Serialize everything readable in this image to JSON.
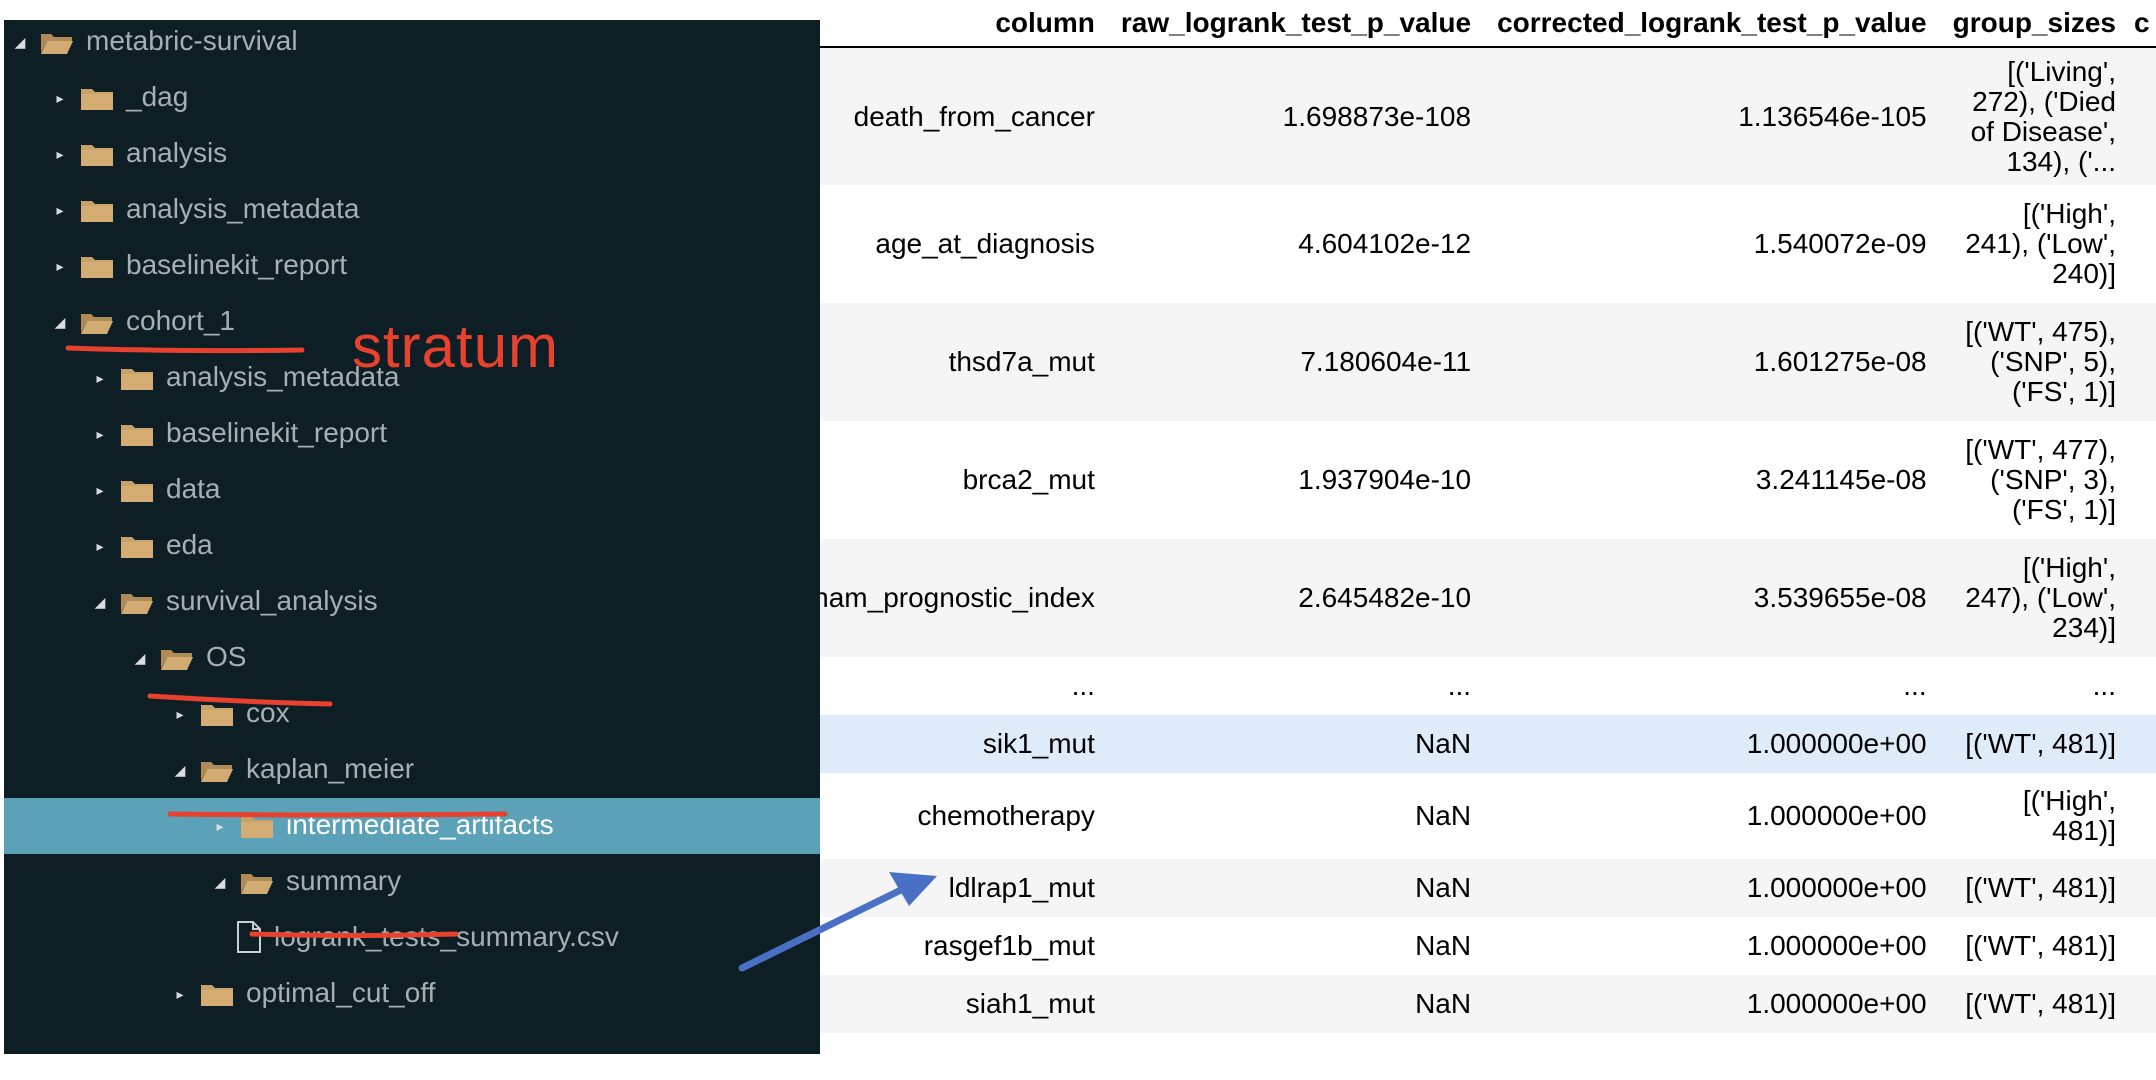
{
  "table": {
    "headers": [
      "column",
      "raw_logrank_test_p_value",
      "corrected_logrank_test_p_value",
      "group_sizes",
      "c"
    ],
    "rows": [
      {
        "column": "death_from_cancer",
        "raw": "1.698873e-108",
        "corrected": "1.136546e-105",
        "group_sizes": "[('Living', 272), ('Died of Disease', 134), ('...",
        "extra": "",
        "style": "odd"
      },
      {
        "column": "age_at_diagnosis",
        "raw": "4.604102e-12",
        "corrected": "1.540072e-09",
        "group_sizes": "[('High', 241), ('Low', 240)]",
        "extra": "",
        "style": "even"
      },
      {
        "column": "thsd7a_mut",
        "raw": "7.180604e-11",
        "corrected": "1.601275e-08",
        "group_sizes": "[('WT', 475), ('SNP', 5), ('FS', 1)]",
        "extra": "",
        "style": "odd"
      },
      {
        "column": "brca2_mut",
        "raw": "1.937904e-10",
        "corrected": "3.241145e-08",
        "group_sizes": "[('WT', 477), ('SNP', 3), ('FS', 1)]",
        "extra": "",
        "style": "even"
      },
      {
        "column": "nottingham_prognostic_index",
        "raw": "2.645482e-10",
        "corrected": "3.539655e-08",
        "group_sizes": "[('High', 247), ('Low', 234)]",
        "extra": "",
        "style": "odd"
      },
      {
        "column": "...",
        "raw": "...",
        "corrected": "...",
        "group_sizes": "...",
        "extra": "",
        "style": "even"
      },
      {
        "column": "sik1_mut",
        "raw": "NaN",
        "corrected": "1.000000e+00",
        "group_sizes": "[('WT', 481)]",
        "extra": "",
        "style": "hover"
      },
      {
        "column": "chemotherapy",
        "raw": "NaN",
        "corrected": "1.000000e+00",
        "group_sizes": "[('High', 481)]",
        "extra": "",
        "style": "even"
      },
      {
        "column": "ldlrap1_mut",
        "raw": "NaN",
        "corrected": "1.000000e+00",
        "group_sizes": "[('WT', 481)]",
        "extra": "",
        "style": "odd"
      },
      {
        "column": "rasgef1b_mut",
        "raw": "NaN",
        "corrected": "1.000000e+00",
        "group_sizes": "[('WT', 481)]",
        "extra": "",
        "style": "even"
      },
      {
        "column": "siah1_mut",
        "raw": "NaN",
        "corrected": "1.000000e+00",
        "group_sizes": "[('WT', 481)]",
        "extra": "",
        "style": "odd"
      }
    ]
  },
  "tree": [
    {
      "label": "metabric-survival",
      "depth": 0,
      "kind": "folder",
      "expanded": true,
      "selected": false
    },
    {
      "label": "_dag",
      "depth": 1,
      "kind": "folder",
      "expanded": false,
      "selected": false
    },
    {
      "label": "analysis",
      "depth": 1,
      "kind": "folder",
      "expanded": false,
      "selected": false
    },
    {
      "label": "analysis_metadata",
      "depth": 1,
      "kind": "folder",
      "expanded": false,
      "selected": false
    },
    {
      "label": "baselinekit_report",
      "depth": 1,
      "kind": "folder",
      "expanded": false,
      "selected": false
    },
    {
      "label": "cohort_1",
      "depth": 1,
      "kind": "folder",
      "expanded": true,
      "selected": false
    },
    {
      "label": "analysis_metadata",
      "depth": 2,
      "kind": "folder",
      "expanded": false,
      "selected": false
    },
    {
      "label": "baselinekit_report",
      "depth": 2,
      "kind": "folder",
      "expanded": false,
      "selected": false
    },
    {
      "label": "data",
      "depth": 2,
      "kind": "folder",
      "expanded": false,
      "selected": false
    },
    {
      "label": "eda",
      "depth": 2,
      "kind": "folder",
      "expanded": false,
      "selected": false
    },
    {
      "label": "survival_analysis",
      "depth": 2,
      "kind": "folder",
      "expanded": true,
      "selected": false
    },
    {
      "label": "OS",
      "depth": 3,
      "kind": "folder",
      "expanded": true,
      "selected": false
    },
    {
      "label": "cox",
      "depth": 4,
      "kind": "folder",
      "expanded": false,
      "selected": false
    },
    {
      "label": "kaplan_meier",
      "depth": 4,
      "kind": "folder",
      "expanded": true,
      "selected": false
    },
    {
      "label": "intermediate_artifacts",
      "depth": 5,
      "kind": "folder",
      "expanded": false,
      "selected": true
    },
    {
      "label": "summary",
      "depth": 5,
      "kind": "folder",
      "expanded": true,
      "selected": false
    },
    {
      "label": "logrank_tests_summary.csv",
      "depth": 6,
      "kind": "file",
      "expanded": false,
      "selected": false
    },
    {
      "label": "optimal_cut_off",
      "depth": 4,
      "kind": "folder",
      "expanded": false,
      "selected": false
    }
  ],
  "annotation": {
    "stratum_label": "stratum",
    "underline_color": "#e8412e",
    "arrow_color": "#4a70c6"
  },
  "colors": {
    "tree_bg": "#0e1e25",
    "tree_text": "#a6afb3",
    "selected_bg": "#5ba1b7",
    "folder": "#c9a26a"
  }
}
